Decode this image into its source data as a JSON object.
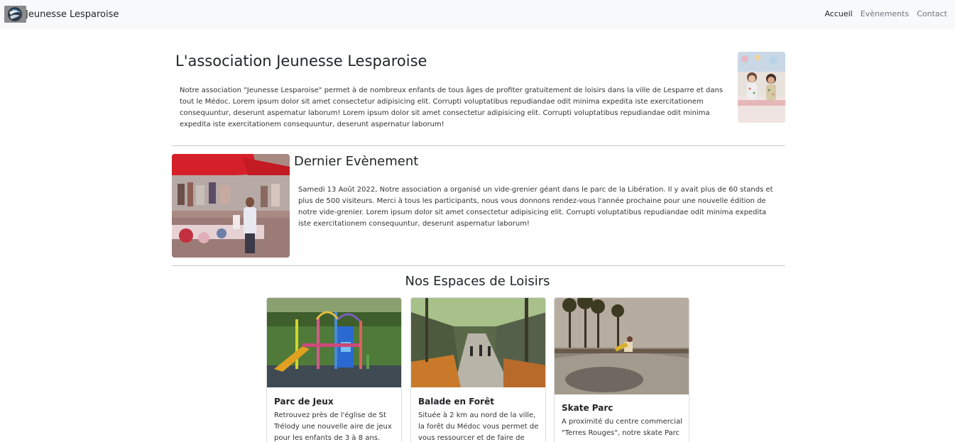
{
  "navbar": {
    "brand": "Jeunesse Lesparoise",
    "links": [
      {
        "label": "Accueil",
        "active": true
      },
      {
        "label": "Evènements",
        "active": false
      },
      {
        "label": "Contact",
        "active": false
      }
    ]
  },
  "about": {
    "title": "L'association Jeunesse Lesparoise",
    "text": "Notre association \"Jeunesse Lesparoise\" permet à de nombreux enfants de tous âges de profiter gratuitement de loisirs dans la ville de Lesparre et dans tout le Médoc. Lorem ipsum dolor sit amet consectetur adipisicing elit. Corrupti voluptatibus repudiandae odit minima expedita iste exercitationem consequuntur, deserunt aspernatur laborum! Lorem ipsum dolor sit amet consectetur adipisicing elit. Corrupti voluptatibus repudiandae odit minima expedita iste exercitationem consequuntur, deserunt aspernatur laborum!"
  },
  "event": {
    "title": "Dernier Evènement",
    "text": "Samedi 13 Août 2022, Notre association a organisé un vide-grenier géant dans le parc de la Libération. Il y avait plus de 60 stands et plus de 500 visiteurs. Merci à tous les participants, nous vous donnons rendez-vous l'année prochaine pour une nouvelle édition de notre vide-grenier. Lorem ipsum dolor sit amet consectetur adipisicing elit. Corrupti voluptatibus repudiandae odit minima expedita iste exercitationem consequuntur, deserunt aspernatur laborum!"
  },
  "leisure": {
    "title": "Nos Espaces de Loisirs",
    "cards": [
      {
        "title": "Parc de Jeux",
        "text": "Retrouvez près de l'église de St Trélody une nouvelle aire de jeux pour les enfants de 3 à 8 ans."
      },
      {
        "title": "Balade en Forêt",
        "text": "Située à 2 km au nord de la ville, la forêt du Médoc vous permet de vous ressourcer et de faire de"
      },
      {
        "title": "Skate Parc",
        "text": "A proximité du centre commercial \"Terres Rouges\", notre skate Parc"
      }
    ]
  }
}
